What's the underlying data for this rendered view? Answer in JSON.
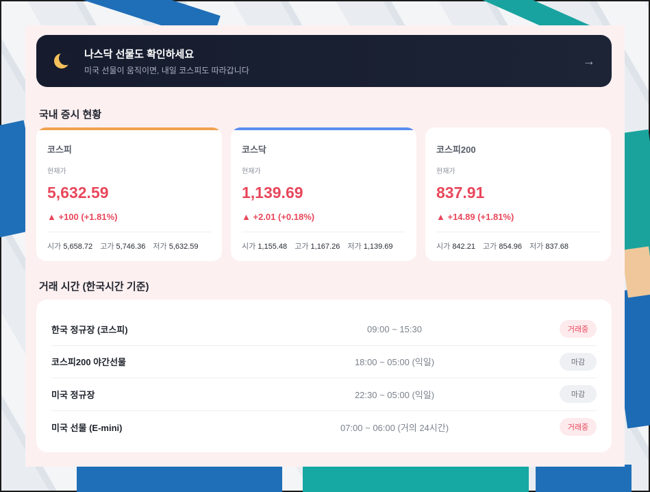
{
  "banner": {
    "title": "나스닥 선물도 확인하세요",
    "subtitle": "미국 선물이 움직이면, 내일 코스피도 따라갑니다",
    "arrow": "→",
    "icon": "moon-icon"
  },
  "market": {
    "title": "국내 증시 현황",
    "cards": [
      {
        "name": "코스피",
        "price_label": "현재가",
        "price": "5,632.59",
        "change": "▲ +100 (+1.81%)",
        "open_label": "시가",
        "open": "5,658.72",
        "high_label": "고가",
        "high": "5,746.36",
        "low_label": "저가",
        "low": "5,632.59",
        "accent": "#f0a24f"
      },
      {
        "name": "코스닥",
        "price_label": "현재가",
        "price": "1,139.69",
        "change": "▲ +2.01 (+0.18%)",
        "open_label": "시가",
        "open": "1,155.48",
        "high_label": "고가",
        "high": "1,167.26",
        "low_label": "저가",
        "low": "1,139.69",
        "accent": "#5b8def"
      },
      {
        "name": "코스피200",
        "price_label": "현재가",
        "price": "837.91",
        "change": "▲ +14.89 (+1.81%)",
        "open_label": "시가",
        "open": "842.21",
        "high_label": "고가",
        "high": "854.96",
        "low_label": "저가",
        "low": "837.68",
        "accent": ""
      }
    ]
  },
  "hours": {
    "title": "거래 시간 (한국시간 기준)",
    "rows": [
      {
        "name": "한국 정규장 (코스피)",
        "time": "09:00 ~ 15:30",
        "status": "거래중"
      },
      {
        "name": "코스피200 야간선물",
        "time": "18:00 ~ 05:00 (익일)",
        "status": "마감"
      },
      {
        "name": "미국 정규장",
        "time": "22:30 ~ 05:00 (익일)",
        "status": "마감"
      },
      {
        "name": "미국 선물 (E-mini)",
        "time": "07:00 ~ 06:00 (거의 24시간)",
        "status": "거래중"
      }
    ]
  },
  "colors": {
    "up": "#e8475b",
    "open_badge_bg": "#fdeaec",
    "closed_badge_bg": "#eef0f3",
    "banner_bg": "#161c2e"
  }
}
